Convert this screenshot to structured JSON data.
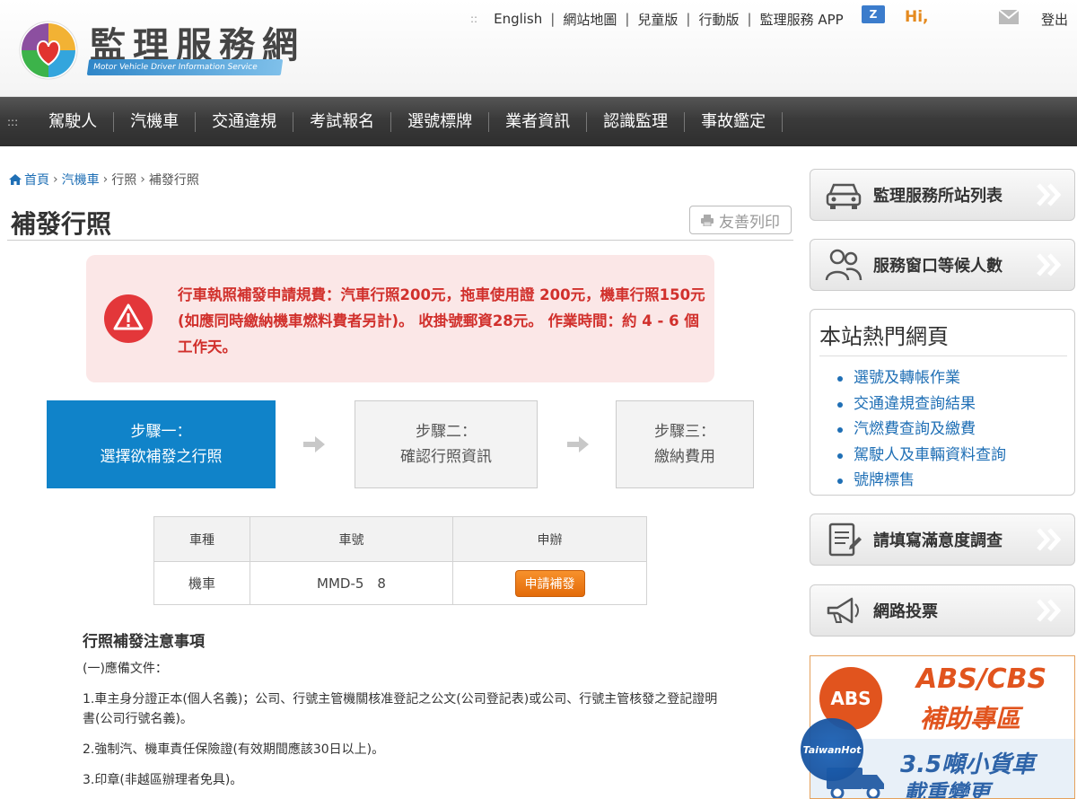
{
  "header": {
    "site_title": "監理服務網",
    "site_subtitle": "Motor Vehicle Driver Information Service",
    "links": [
      "English",
      "網站地圖",
      "兒童版",
      "行動版",
      "監理服務 APP"
    ],
    "dots": "::",
    "lang_icon": "Z",
    "greeting": "Hi,",
    "logout": "登出"
  },
  "nav": {
    "dots": ":::",
    "items": [
      "駕駛人",
      "汽機車",
      "交通違規",
      "考試報名",
      "選號標牌",
      "業者資訊",
      "認識監理",
      "事故鑑定"
    ]
  },
  "breadcrumb": {
    "home": "首頁",
    "level1": "汽機車",
    "level2": "行照",
    "current": "補發行照",
    "sep": "›"
  },
  "page": {
    "title": "補發行照",
    "print_label": "友善列印"
  },
  "alert": {
    "text": "行車執照補發申請規費：汽車行照200元，拖車使用證 200元，機車行照150元(如應同時繳納機車燃料費者另計)。 收掛號郵資28元。 作業時間：約 4 - 6 個工作天。"
  },
  "steps": [
    {
      "line1": "步驟一：",
      "line2": "選擇欲補發之行照"
    },
    {
      "line1": "步驟二：",
      "line2": "確認行照資訊"
    },
    {
      "line1": "步驟三：",
      "line2": "繳納費用"
    }
  ],
  "table": {
    "headers": [
      "車種",
      "車號",
      "申辦"
    ],
    "rows": [
      {
        "type": "機車",
        "plate": "MMD-5　8",
        "action": "申請補發"
      }
    ]
  },
  "notes": {
    "heading": "行照補發注意事項",
    "items": [
      "(一)應備文件：",
      "1.車主身分證正本(個人名義)；公司、行號主管機關核准登記之公文(公司登記表)或公司、行號主管核發之登記證明書(公司行號名義)。",
      "2.強制汽、機車責任保險證(有效期間應該30日以上)。",
      "3.印章(非越區辦理者免具)。"
    ]
  },
  "sidebar": {
    "buttons": [
      "監理服務所站列表",
      "服務窗口等候人數",
      "請填寫滿意度調查",
      "網路投票"
    ],
    "hot_title": "本站熱門網頁",
    "hot_links": [
      "選號及轉帳作業",
      "交通違規查詢結果",
      "汽燃費查詢及繳費",
      "駕駛人及車輛資料查詢",
      "號牌標售"
    ],
    "banner": {
      "badge": "ABS",
      "title1": "ABS/CBS",
      "title2": "補助專區",
      "title3": "3.5噸小貨車",
      "title4": "載重變更"
    },
    "watermark": "TaiwanHot"
  },
  "colors": {
    "accent": "#1083c9",
    "alert_bg": "#fbe7e7",
    "alert_text": "#d1302c",
    "apply_button": "#f08320",
    "link": "#1f6fb5"
  }
}
